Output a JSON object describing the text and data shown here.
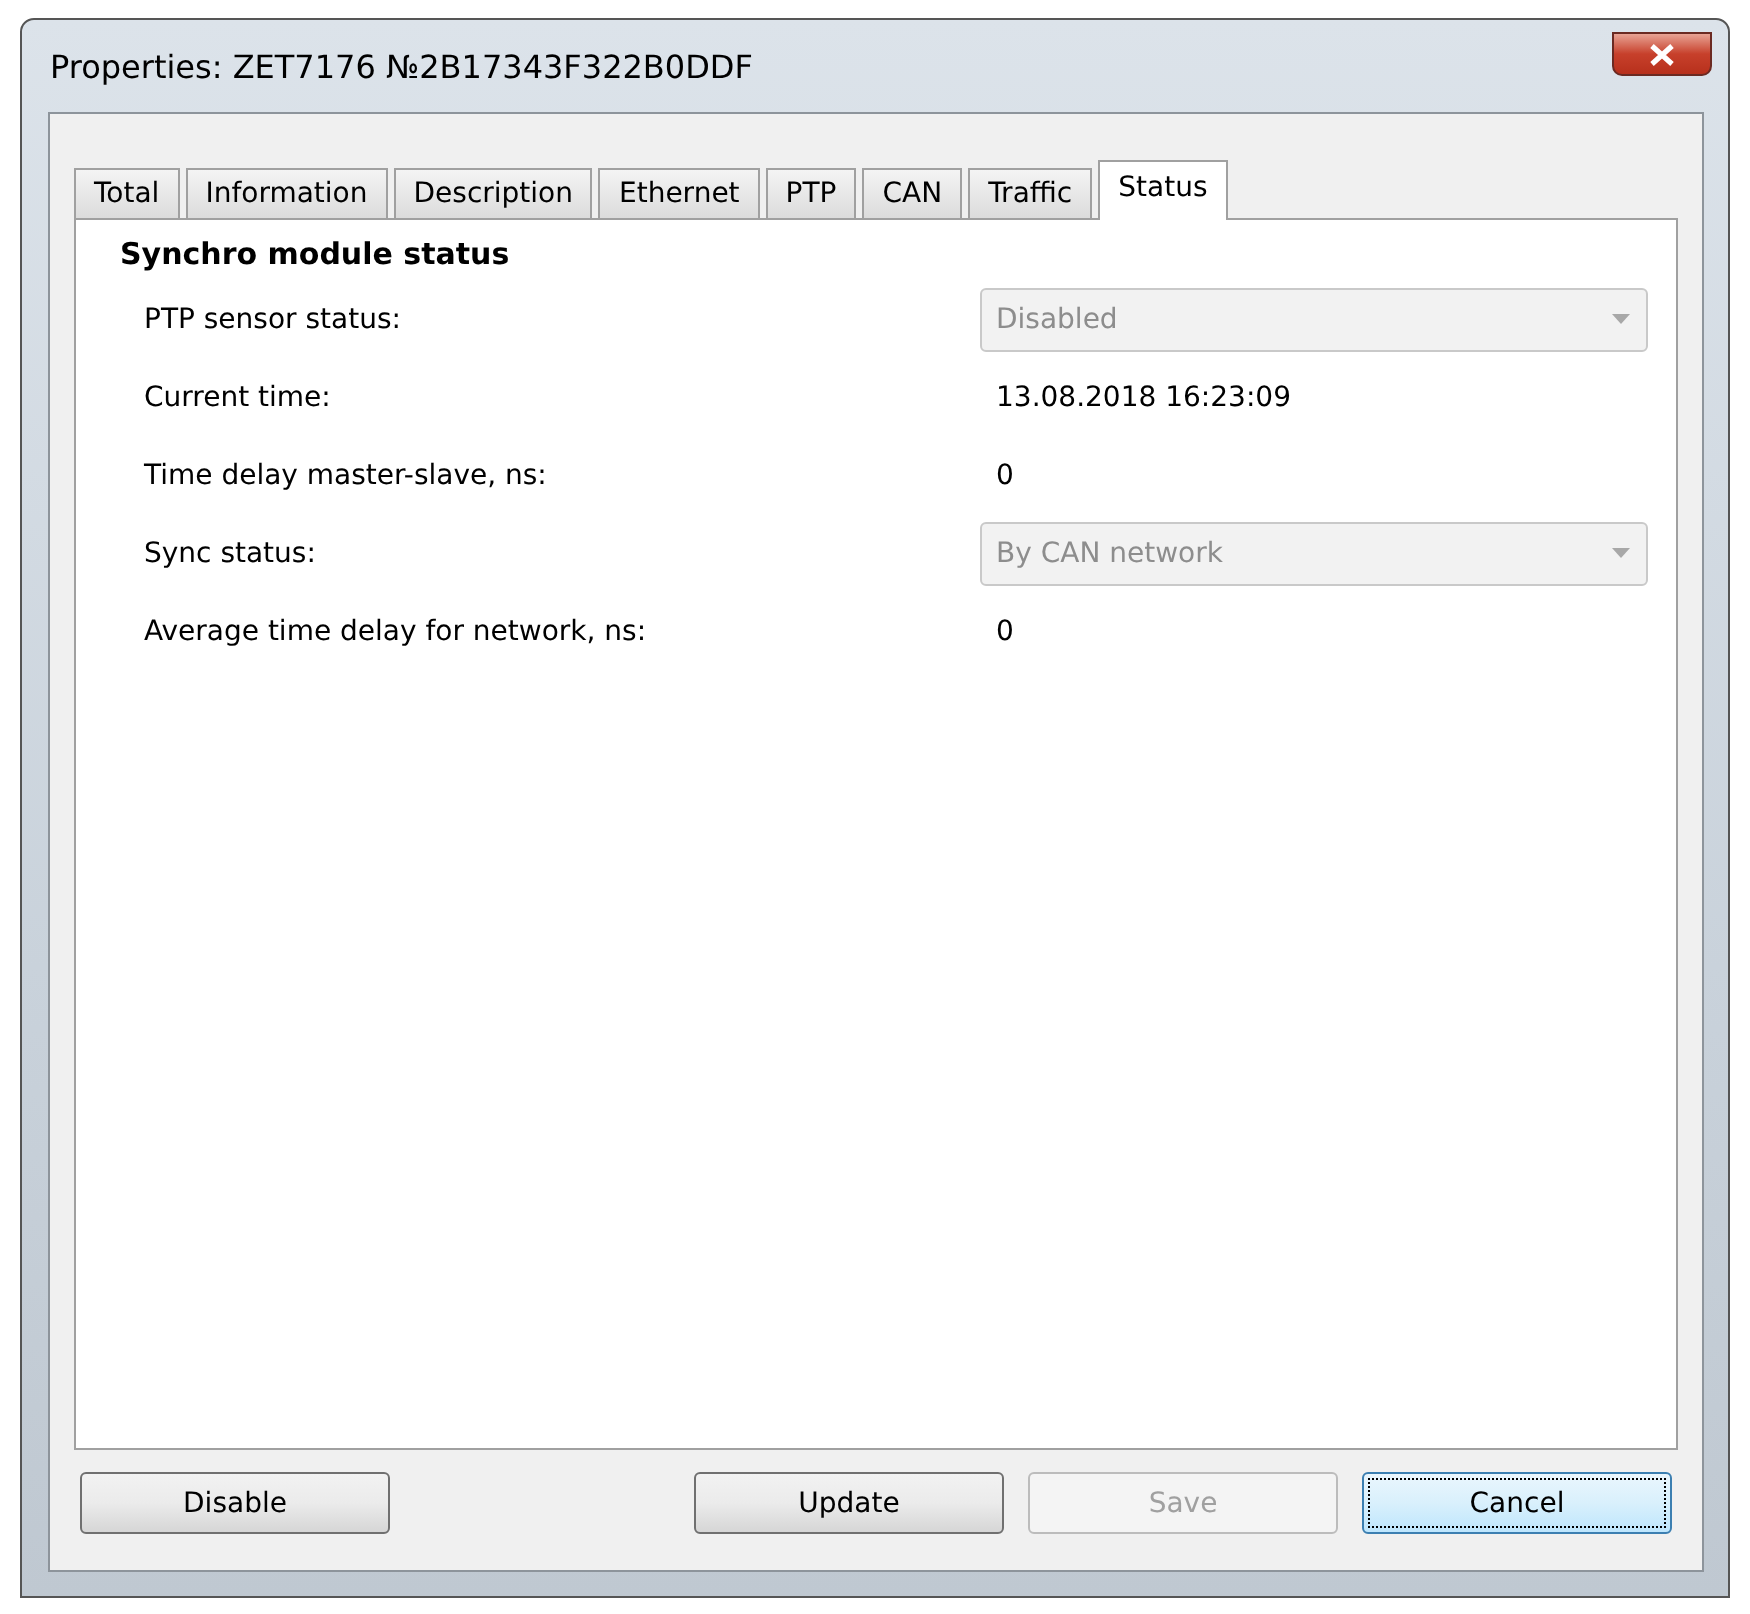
{
  "window": {
    "title": "Properties: ZET7176 №2B17343F322B0DDF"
  },
  "tabs": [
    {
      "label": "Total",
      "selected": false
    },
    {
      "label": "Information",
      "selected": false
    },
    {
      "label": "Description",
      "selected": false
    },
    {
      "label": "Ethernet",
      "selected": false
    },
    {
      "label": "PTP",
      "selected": false
    },
    {
      "label": "CAN",
      "selected": false
    },
    {
      "label": "Traffic",
      "selected": false
    },
    {
      "label": "Status",
      "selected": true
    }
  ],
  "section": {
    "title": "Synchro module status"
  },
  "rows": [
    {
      "kind": "dropdown",
      "label": "PTP sensor status:",
      "value": "Disabled",
      "disabled": true
    },
    {
      "kind": "text",
      "label": "Current time:",
      "value": "13.08.2018 16:23:09"
    },
    {
      "kind": "text",
      "label": "Time delay master-slave, ns:",
      "value": "0"
    },
    {
      "kind": "dropdown",
      "label": "Sync status:",
      "value": "By CAN network",
      "disabled": true
    },
    {
      "kind": "text",
      "label": "Average time delay for network, ns:",
      "value": "0"
    }
  ],
  "buttons": [
    {
      "label": "Disable",
      "disabled": false,
      "focused": false
    },
    {
      "label": "Update",
      "disabled": false,
      "focused": false
    },
    {
      "label": "Save",
      "disabled": true,
      "focused": false
    },
    {
      "label": "Cancel",
      "disabled": false,
      "focused": true
    }
  ]
}
